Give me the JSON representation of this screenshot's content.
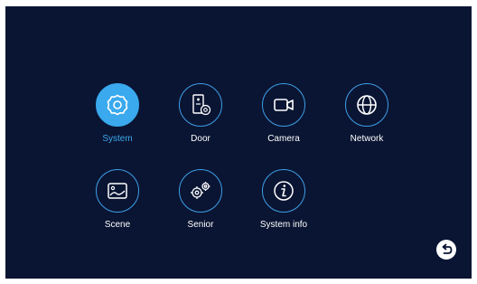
{
  "menu": {
    "items": [
      {
        "label": "System",
        "icon": "gear-icon",
        "selected": true
      },
      {
        "label": "Door",
        "icon": "door-settings-icon",
        "selected": false
      },
      {
        "label": "Camera",
        "icon": "camera-icon",
        "selected": false
      },
      {
        "label": "Network",
        "icon": "globe-icon",
        "selected": false
      },
      {
        "label": "Scene",
        "icon": "landscape-icon",
        "selected": false
      },
      {
        "label": "Senior",
        "icon": "gears-icon",
        "selected": false
      },
      {
        "label": "System info",
        "icon": "info-icon",
        "selected": false
      }
    ]
  },
  "back": {
    "icon": "back-arrow-icon"
  },
  "colors": {
    "background": "#0a1533",
    "accent": "#3aa9ee",
    "icon_outline": "#3d9fe6",
    "text": "#ffffff"
  }
}
